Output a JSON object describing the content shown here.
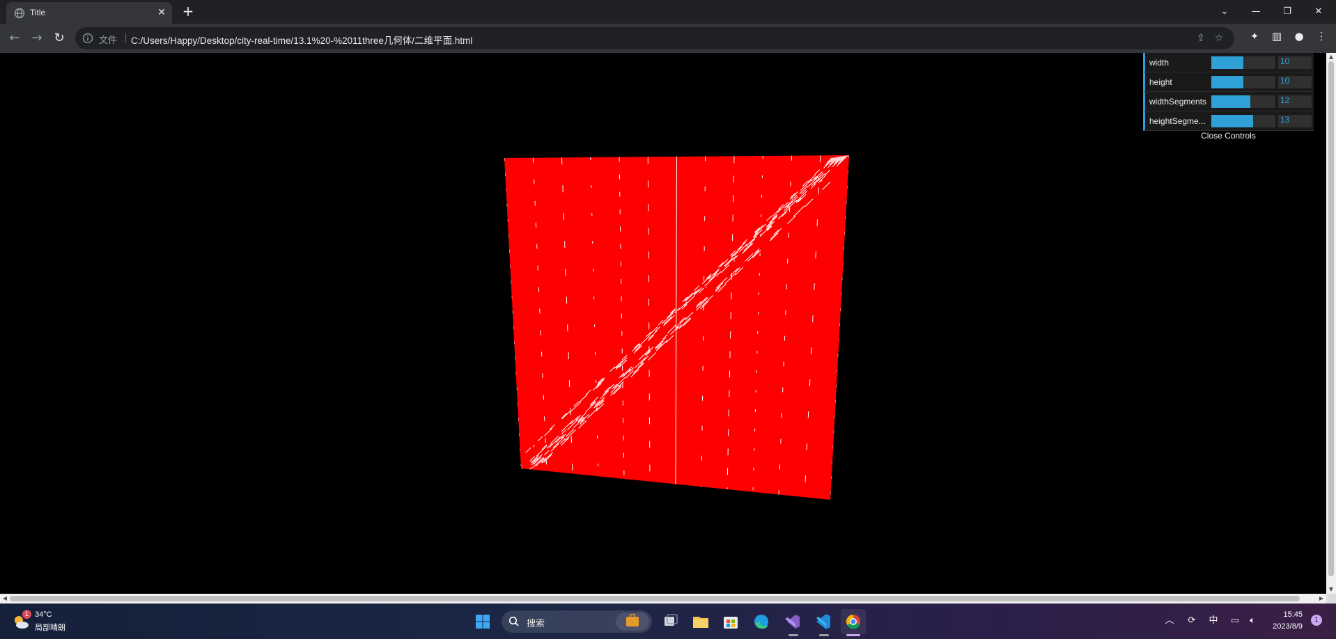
{
  "browser": {
    "tab_title": "Title",
    "tab_close_glyph": "✕",
    "new_tab_glyph": "+",
    "scheme_label": "文件",
    "url": "C:/Users/Happy/Desktop/city-real-time/13.1%20-%2011three几何体/二维平面.html",
    "window_controls": [
      "⌄",
      "—",
      "❐",
      "✕"
    ]
  },
  "gui": {
    "controls": [
      {
        "label": "width",
        "value": "10",
        "fraction": 0.5
      },
      {
        "label": "height",
        "value": "10",
        "fraction": 0.5
      },
      {
        "label": "widthSegments",
        "value": "12",
        "fraction": 0.6
      },
      {
        "label": "heightSegme...",
        "value": "13",
        "fraction": 0.65
      }
    ],
    "close_label": "Close Controls"
  },
  "scene": {
    "plane_color": "#ff0000",
    "wire_color": "#ffffff"
  },
  "taskbar": {
    "weather_temp": "34°C",
    "weather_desc": "局部晴朗",
    "weather_badge": "1",
    "search_placeholder": "搜索",
    "ime_label": "中",
    "time": "15:45",
    "date": "2023/8/9",
    "notification_count": "1"
  },
  "colors": {
    "accent": "#2fa1d6"
  }
}
